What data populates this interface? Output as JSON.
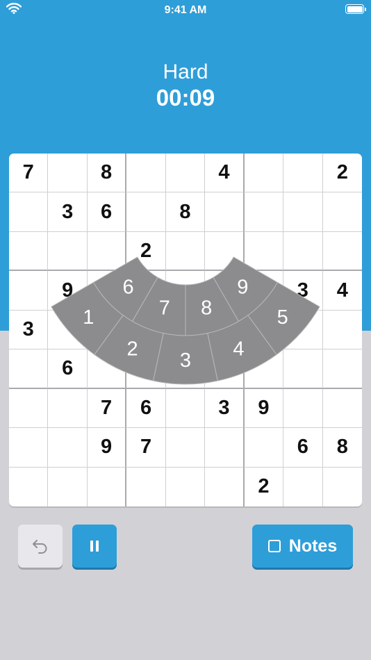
{
  "status_bar": {
    "time": "9:41 AM"
  },
  "game": {
    "difficulty": "Hard",
    "timer": "00:09"
  },
  "board": {
    "cells": [
      [
        "7",
        "",
        "8",
        "",
        "",
        "4",
        "",
        "",
        "2"
      ],
      [
        "",
        "3",
        "6",
        "",
        "8",
        "",
        "",
        "",
        ""
      ],
      [
        "",
        "",
        "",
        "2",
        "",
        "",
        "",
        "",
        ""
      ],
      [
        "",
        "9",
        "",
        "",
        "",
        "",
        "",
        "3",
        "4"
      ],
      [
        "3",
        "",
        "",
        "",
        "",
        "",
        "",
        "",
        ""
      ],
      [
        "",
        "6",
        "",
        "",
        "",
        "",
        "",
        "",
        ""
      ],
      [
        "",
        "",
        "7",
        "6",
        "",
        "3",
        "9",
        "",
        ""
      ],
      [
        "",
        "",
        "9",
        "7",
        "",
        "",
        "",
        "6",
        "8"
      ],
      [
        "",
        "",
        "",
        "",
        "",
        "",
        "2",
        "",
        ""
      ]
    ]
  },
  "number_picker": {
    "inner_ring": [
      "6",
      "7",
      "8",
      "9"
    ],
    "outer_ring": [
      "1",
      "2",
      "3",
      "4",
      "5"
    ]
  },
  "controls": {
    "notes_label": "Notes"
  },
  "icons": {
    "undo": "undo-arrow-icon",
    "pause": "pause-icon",
    "notes": "checkbox-icon",
    "wifi": "wifi-icon",
    "battery": "battery-icon"
  },
  "colors": {
    "accent": "#2e9ed8",
    "picker": "#8c8c8e",
    "background": "#d2d1d6"
  }
}
